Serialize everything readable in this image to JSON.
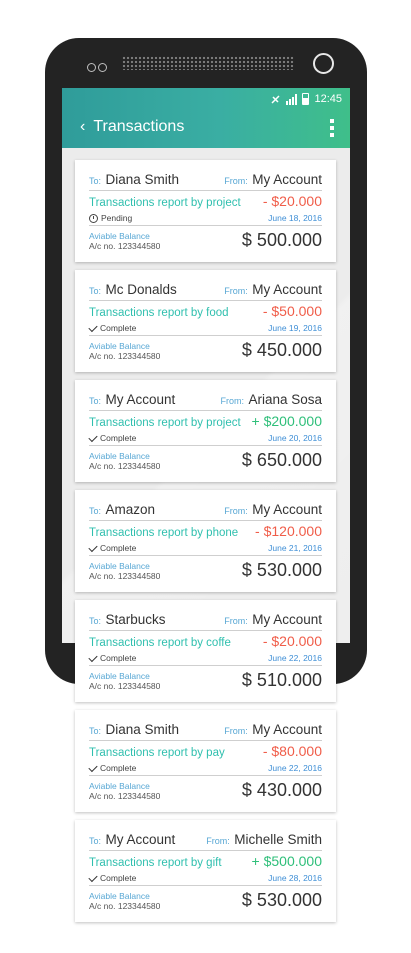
{
  "status_bar": {
    "time": "12:45"
  },
  "app_bar": {
    "back_glyph": "‹",
    "title": "Transactions"
  },
  "labels": {
    "to": "To:",
    "from": "From:",
    "balance": "Aviable Balance",
    "acc_prefix": "A/c no."
  },
  "transactions": [
    {
      "to": "Diana Smith",
      "from": "My Account",
      "description": "Transactions report by project",
      "amount": "- $20.000",
      "type": "neg",
      "status": "Pending",
      "status_icon": "clock-icon",
      "date": "June 18, 2016",
      "account": "123344580",
      "balance": "$ 500.000"
    },
    {
      "to": "Mc Donalds",
      "from": "My Account",
      "description": "Transactions report by food",
      "amount": "- $50.000",
      "type": "neg",
      "status": "Complete",
      "status_icon": "check-icon",
      "date": "June 19, 2016",
      "account": "123344580",
      "balance": "$ 450.000"
    },
    {
      "to": "My Account",
      "from": "Ariana Sosa",
      "description": "Transactions report by project",
      "amount": "+ $200.000",
      "type": "pos",
      "status": "Complete",
      "status_icon": "check-icon",
      "date": "June 20, 2016",
      "account": "123344580",
      "balance": "$ 650.000"
    },
    {
      "to": "Amazon",
      "from": "My Account",
      "description": "Transactions report by phone",
      "amount": "- $120.000",
      "type": "neg",
      "status": "Complete",
      "status_icon": "check-icon",
      "date": "June 21, 2016",
      "account": "123344580",
      "balance": "$ 530.000"
    },
    {
      "to": "Starbucks",
      "from": "My Account",
      "description": "Transactions report by coffe",
      "amount": "- $20.000",
      "type": "neg",
      "status": "Complete",
      "status_icon": "check-icon",
      "date": "June 22, 2016",
      "account": "123344580",
      "balance": "$ 510.000"
    },
    {
      "to": "Diana Smith",
      "from": "My Account",
      "description": "Transactions report by pay",
      "amount": "- $80.000",
      "type": "neg",
      "status": "Complete",
      "status_icon": "check-icon",
      "date": "June 22, 2016",
      "account": "123344580",
      "balance": "$ 430.000"
    },
    {
      "to": "My Account",
      "from": "Michelle Smith",
      "description": "Transactions report by gift",
      "amount": "+ $500.000",
      "type": "pos",
      "status": "Complete",
      "status_icon": "check-icon",
      "date": "June 28, 2016",
      "account": "123344580",
      "balance": "$ 530.000"
    }
  ],
  "colors": {
    "accent_start": "#2f9c9a",
    "accent_end": "#3fbf8a",
    "negative": "#f05d49",
    "positive": "#2fbf7a",
    "link": "#57a7d4"
  }
}
